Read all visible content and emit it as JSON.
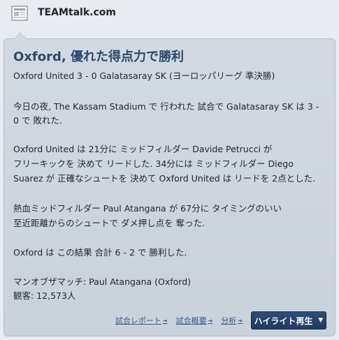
{
  "source": {
    "name": "TEAMtalk.com",
    "icon": "newspaper-icon"
  },
  "article": {
    "headline": "Oxford, 優れた得点力で勝利",
    "result_line": "Oxford United 3 - 0 Galatasaray SK (ヨーロッパリーグ 準決勝)",
    "para1": [
      "今日の夜, The Kassam Stadium で 行われた 試合で Galatasaray SK は 3 -",
      "0 で 敗れた."
    ],
    "para2": [
      "Oxford United は 21分に ミッドフィルダー Davide Petrucci が",
      "フリーキックを 決めて リードした. 34分には ミッドフィルダー Diego",
      "Suarez が 正確なシュートを 決めて Oxford United は リードを 2点とした."
    ],
    "para3": [
      "熱血ミッドフィルダー Paul Atangana が 67分に タイミングのいい",
      "至近距離からのシュートで ダメ押し点を 奪った."
    ],
    "para4": "Oxford は この結果 合計 6 - 2 で 勝利した.",
    "man_of_match": "マンオブザマッチ: Paul Atangana (Oxford)",
    "attendance": "観客: 12,573人"
  },
  "links": {
    "match_report": "試合レポート",
    "match_overview": "試合概要",
    "analysis": "分析",
    "highlights_button": "ハイライト再生"
  }
}
